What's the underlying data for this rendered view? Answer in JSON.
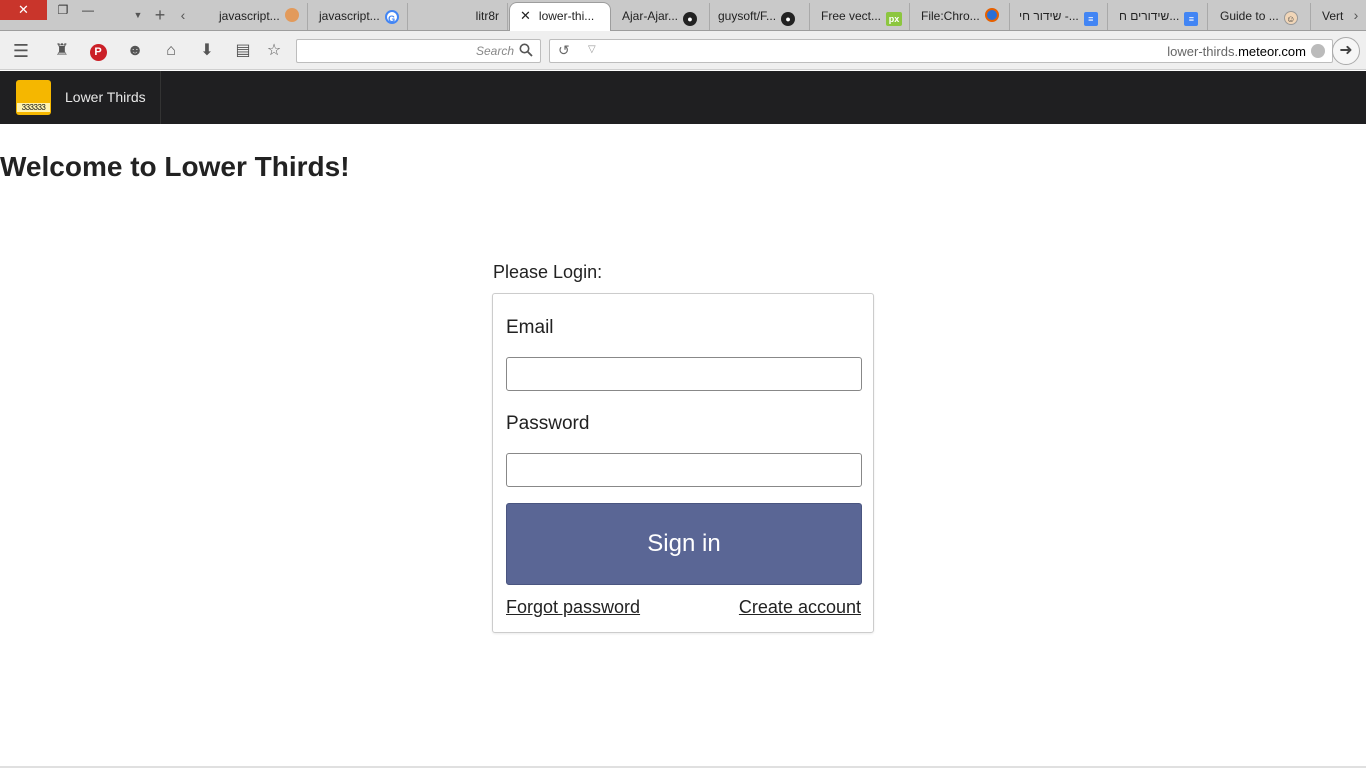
{
  "browser": {
    "tabs": [
      {
        "label": "javascript...",
        "favicon": "flame-icon"
      },
      {
        "label": "javascript...",
        "favicon": "google-icon"
      },
      {
        "label": "litr8r",
        "favicon": ""
      },
      {
        "label": "lower-thi...",
        "favicon": "close-icon",
        "active": true
      },
      {
        "label": "Ajar-Ajar...",
        "favicon": "github-icon"
      },
      {
        "label": "guysoft/F...",
        "favicon": "github-icon"
      },
      {
        "label": "Free vect...",
        "favicon": "px-icon"
      },
      {
        "label": "File:Chro...",
        "favicon": "firefox-icon"
      },
      {
        "label": "שידור חי -...",
        "favicon": "docs-icon"
      },
      {
        "label": "שידורים ח...",
        "favicon": "docs-icon"
      },
      {
        "label": "Guide to ...",
        "favicon": "face-icon"
      },
      {
        "label": "Vert",
        "favicon": ""
      }
    ],
    "search_placeholder": "Search",
    "url_prefix": "lower-thirds.",
    "url_domain": "meteor.com"
  },
  "site": {
    "logo_text": "333333",
    "brand_name": "Lower Thirds",
    "heading": "Welcome to Lower Thirds!",
    "login_prompt": "Please Login:",
    "email_label": "Email",
    "email_value": "",
    "password_label": "Password",
    "password_value": "",
    "signin_label": "Sign in",
    "forgot_label": "Forgot password",
    "create_label": "Create account"
  },
  "colors": {
    "navbar": "#1f1f21",
    "logo": "#f5b700",
    "signin_button": "#5a6695",
    "close_window": "#c9352b"
  }
}
